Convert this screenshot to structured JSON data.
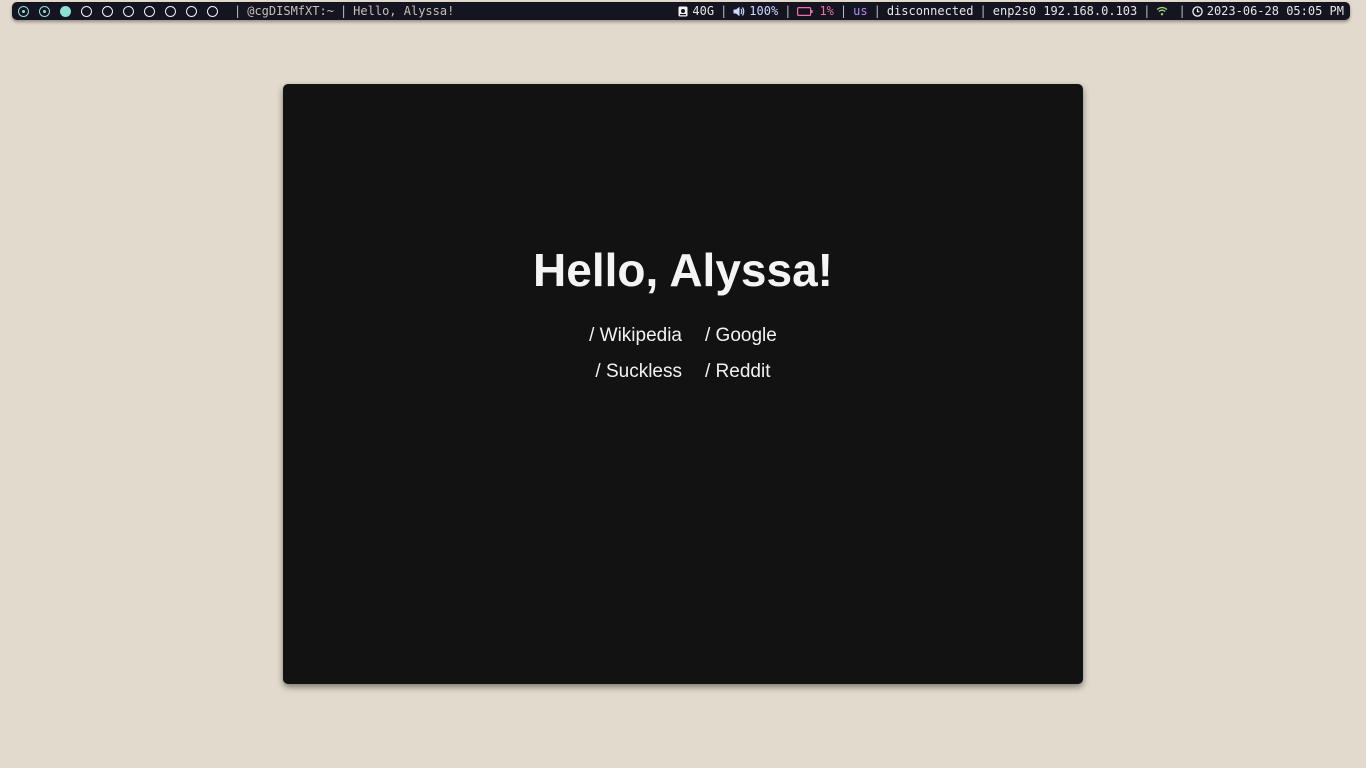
{
  "topbar": {
    "workspaces": [
      {
        "state": "occupied"
      },
      {
        "state": "occupied"
      },
      {
        "state": "active"
      },
      {
        "state": "empty"
      },
      {
        "state": "empty"
      },
      {
        "state": "empty"
      },
      {
        "state": "empty"
      },
      {
        "state": "empty"
      },
      {
        "state": "empty"
      },
      {
        "state": "empty"
      }
    ],
    "separator": "|",
    "terminal_title": "@cgDISMfXT:~",
    "window_title": "Hello, Alyssa!",
    "disk": "40G",
    "disk_icon": "disk-icon",
    "volume": "100%",
    "volume_icon": "speaker-icon",
    "battery": "1%",
    "battery_icon": "battery-icon",
    "keyboard_layout": "us",
    "wifi_status": "disconnected",
    "ethernet": "enp2s0 192.168.0.103",
    "wifi_icon": "wifi-icon",
    "clock_icon": "clock-icon",
    "datetime": "2023-06-28 05:05 PM",
    "colors": {
      "bar_bg": "#151421",
      "workspace_accent": "#8fe0d4",
      "volume": "#cfd8ff",
      "battery": "#f06fa0",
      "keyboard": "#b08cf0",
      "wifi": "#9ad67e"
    }
  },
  "page": {
    "greeting": "Hello, Alyssa!",
    "links": {
      "wikipedia": "/ Wikipedia",
      "google": "/ Google",
      "suckless": "/ Suckless",
      "reddit": "/ Reddit"
    },
    "colors": {
      "desktop_bg": "#e2dacd",
      "window_bg": "#121212",
      "text": "#f4f4f4"
    }
  }
}
